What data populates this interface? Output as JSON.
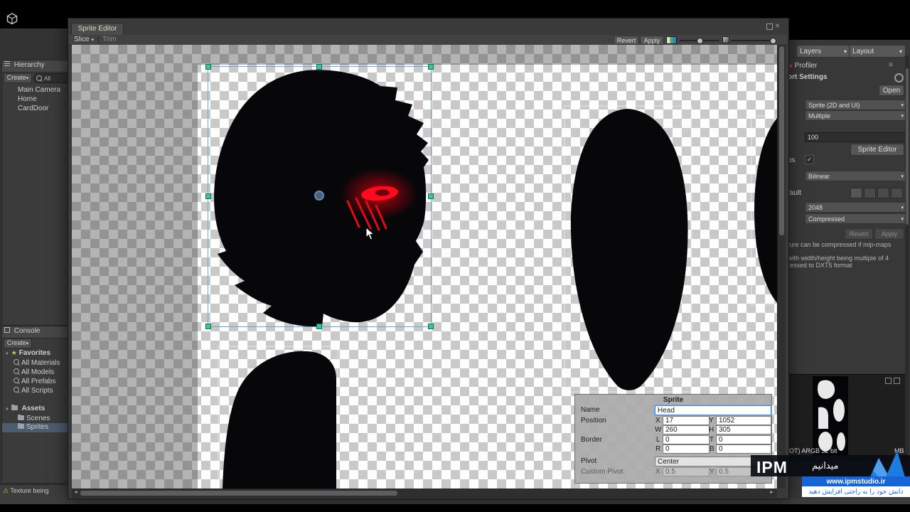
{
  "glyphs": {
    "dropdown": "▾",
    "star": "★",
    "warning": "⚠",
    "check": "✓",
    "menu": "≡",
    "scroll_left": "◄",
    "scroll_right": "►",
    "record_dot": "●",
    "close": "×",
    "expand": "▼",
    "collapse": "▶"
  },
  "colors": {
    "eye_glow": "#ff0019",
    "selection_handle": "#3ec48e",
    "pivot_ring": "#4a90d9",
    "watermark_blue": "#1565d8"
  },
  "hierarchy": {
    "title": "Hierarchy",
    "create": "Create",
    "search_filter": "All",
    "items": [
      "Main Camera",
      "Home",
      "CardDoor"
    ]
  },
  "project": {
    "tab": "Console",
    "create": "Create",
    "favorites": "Favorites",
    "favorite_items": [
      "All Materials",
      "All Models",
      "All Prefabs",
      "All Scripts"
    ],
    "assets": "Assets",
    "folders": [
      "Scenes",
      "Sprites"
    ]
  },
  "status": {
    "message": "Texture being"
  },
  "sprite_editor": {
    "tab": "Sprite Editor",
    "slice": "Slice",
    "trim": "Trim",
    "revert": "Revert",
    "apply": "Apply",
    "panel": {
      "title": "Sprite",
      "name_label": "Name",
      "name": "Head",
      "position_label": "Position",
      "x_label": "X",
      "x": "17",
      "y_label": "Y",
      "y": "1052",
      "w_label": "W",
      "w": "260",
      "h_label": "H",
      "h": "305",
      "border_label": "Border",
      "l_label": "L",
      "l": "0",
      "t_label": "T",
      "t": "0",
      "r_label": "R",
      "r": "0",
      "b_label": "B",
      "b": "0",
      "pivot_label": "Pivot",
      "pivot": "Center",
      "custom_pivot_label": "Custom Pivot",
      "cpx_label": "X",
      "cpx": "0.5",
      "cpy_label": "Y",
      "cpy": "0.5"
    }
  },
  "inspector": {
    "layers": "Layers",
    "layout": "Layout",
    "profiler": "Profiler",
    "import_settings": "ort Settings",
    "open": "Open",
    "sprite_mode": "Sprite (2D and UI)",
    "multiple": "Multiple",
    "pixels_per_unit": "100",
    "sprite_editor_button": "Sprite Editor",
    "mipmap_label": "ps",
    "filter_mode": "Bilinear",
    "platform_tab": "fault",
    "max_size": "2048",
    "format": "Compressed",
    "revert": "Revert",
    "apply": "Apply",
    "help_line1": "ture can be compressed if mip-maps",
    "help_line2": "with width/height being multiple of 4",
    "help_line3": "ressed to DXT5 format",
    "preview_format": "OT)  ARGB 32 bit",
    "preview_size": "MB"
  },
  "watermark": {
    "brand": "IPM",
    "title_fa": "میدانیم",
    "url": "www.ipmstudio.ir",
    "tagline_fa": "دانش خود را به راحتی افزایش دهید"
  }
}
